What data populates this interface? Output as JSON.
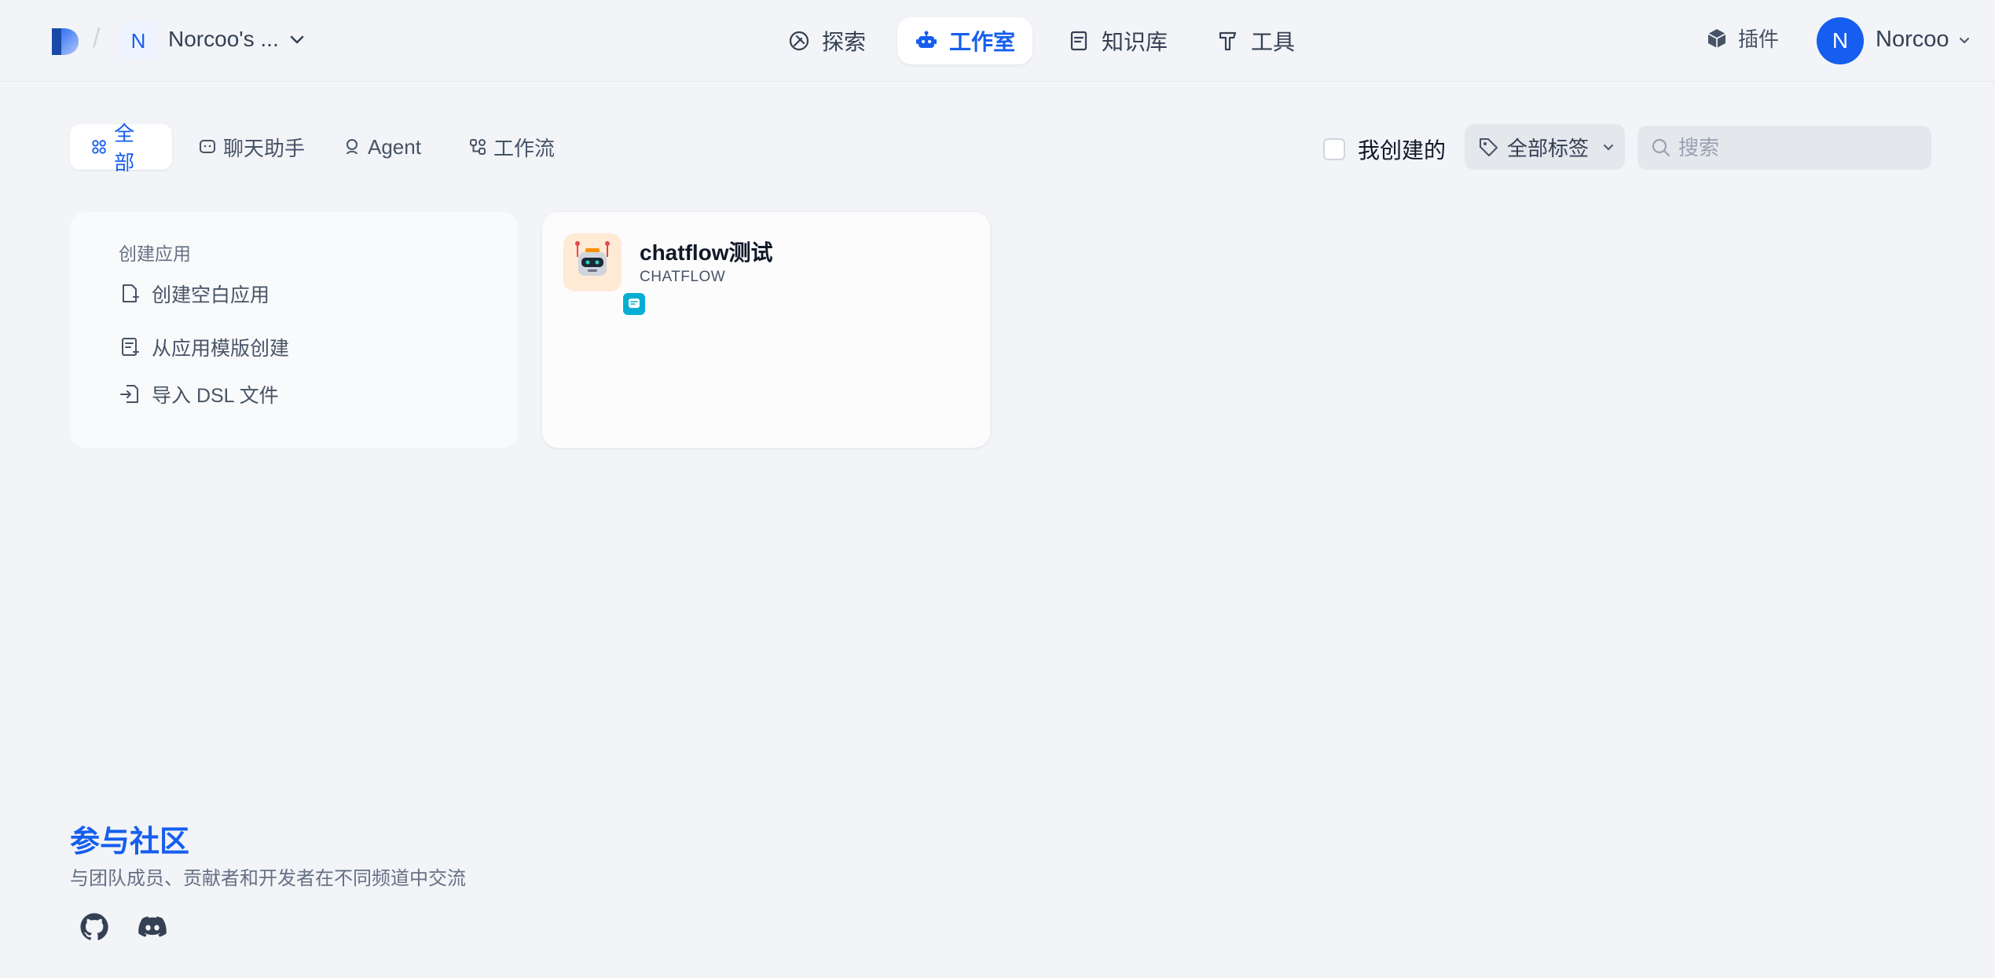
{
  "header": {
    "workspace_initial": "N",
    "workspace_name": "Norcoo's ...",
    "nav": [
      "探索",
      "工作室",
      "知识库",
      "工具"
    ],
    "plugin_label": "插件",
    "user_initial": "N",
    "user_name": "Norcoo"
  },
  "filters": {
    "tabs": [
      "全部",
      "聊天助手",
      "Agent",
      "工作流"
    ],
    "active_tab": "全部",
    "mine_label": "我创建的",
    "tag_label": "全部标签",
    "search_placeholder": "搜索"
  },
  "create_card": {
    "title": "创建应用",
    "items": [
      "创建空白应用",
      "从应用模版创建",
      "导入 DSL 文件"
    ]
  },
  "apps": [
    {
      "name": "chatflow测试",
      "type": "CHATFLOW",
      "icon": "robot-icon"
    }
  ],
  "community": {
    "title": "参与社区",
    "subtitle": "与团队成员、贡献者和开发者在不同频道中交流",
    "links": [
      "github-icon",
      "discord-icon"
    ]
  },
  "colors": {
    "accent": "#155eef",
    "background": "#f2f4f7",
    "app_icon_bg": "#ffead5"
  }
}
